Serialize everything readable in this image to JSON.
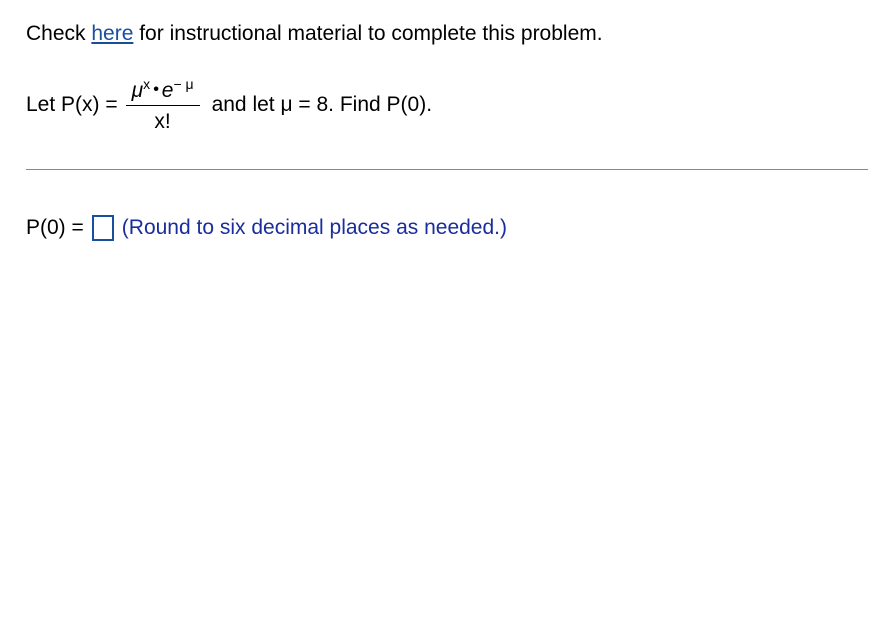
{
  "instruction": {
    "prefix": "Check ",
    "link_text": "here",
    "suffix": " for instructional material to complete this problem."
  },
  "formula": {
    "prefix": "Let P(x) = ",
    "numerator_mu": "μ",
    "numerator_sup_x": "x",
    "numerator_dot": "•",
    "numerator_e": "e",
    "numerator_sup_negmu": "− μ",
    "denominator": "x!",
    "suffix": " and let μ = 8. Find P(0)."
  },
  "answer": {
    "label": "P(0) = ",
    "input_value": "",
    "round_note": "(Round to six decimal places as needed.)"
  }
}
